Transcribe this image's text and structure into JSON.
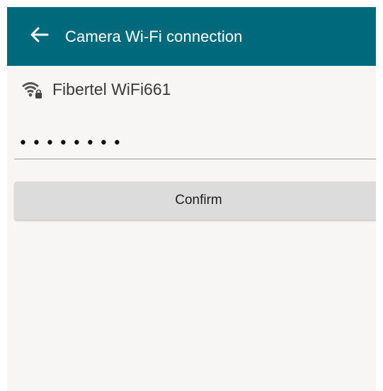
{
  "app_bar": {
    "title": "Camera Wi-Fi connection",
    "back_icon": "arrow-left-icon",
    "background": "#006a7d"
  },
  "network": {
    "icon": "wifi-lock-icon",
    "name": "Fibertel WiFi661"
  },
  "password_field": {
    "masked_value": "••••••••",
    "type": "password"
  },
  "confirm_button": {
    "label": "Confirm"
  }
}
